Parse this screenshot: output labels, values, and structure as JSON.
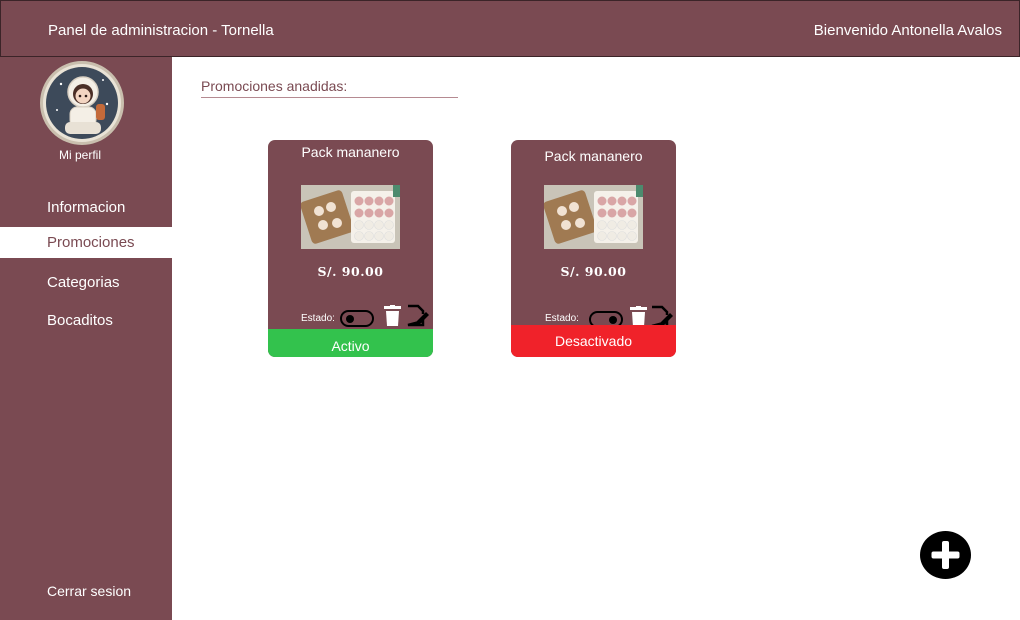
{
  "header": {
    "title": "Panel de administracion - Tornella",
    "welcome": "Bienvenido Antonella Avalos"
  },
  "sidebar": {
    "profile_label": "Mi perfil",
    "items": [
      {
        "label": "Informacion",
        "active": false
      },
      {
        "label": "Promociones",
        "active": true
      },
      {
        "label": "Categorias",
        "active": false
      },
      {
        "label": "Bocaditos",
        "active": false
      }
    ],
    "logout": "Cerrar sesion"
  },
  "main": {
    "section_title": "Promociones anadidas:",
    "cards": [
      {
        "name": "Pack mananero",
        "price": "S/. 90.00",
        "estado_label": "Estado:",
        "status": "Activo",
        "status_color": "#33c24d"
      },
      {
        "name": "Pack mananero",
        "price": "S/. 90.00",
        "estado_label": "Estado:",
        "status": "Desactivado",
        "status_color": "#f0222a"
      }
    ]
  },
  "colors": {
    "brand": "#7a4a52",
    "active": "#33c24d",
    "inactive": "#f0222a"
  },
  "icons": [
    "avatar-astronaut",
    "toggle-icon",
    "trash-icon",
    "edit-icon",
    "plus-icon"
  ]
}
